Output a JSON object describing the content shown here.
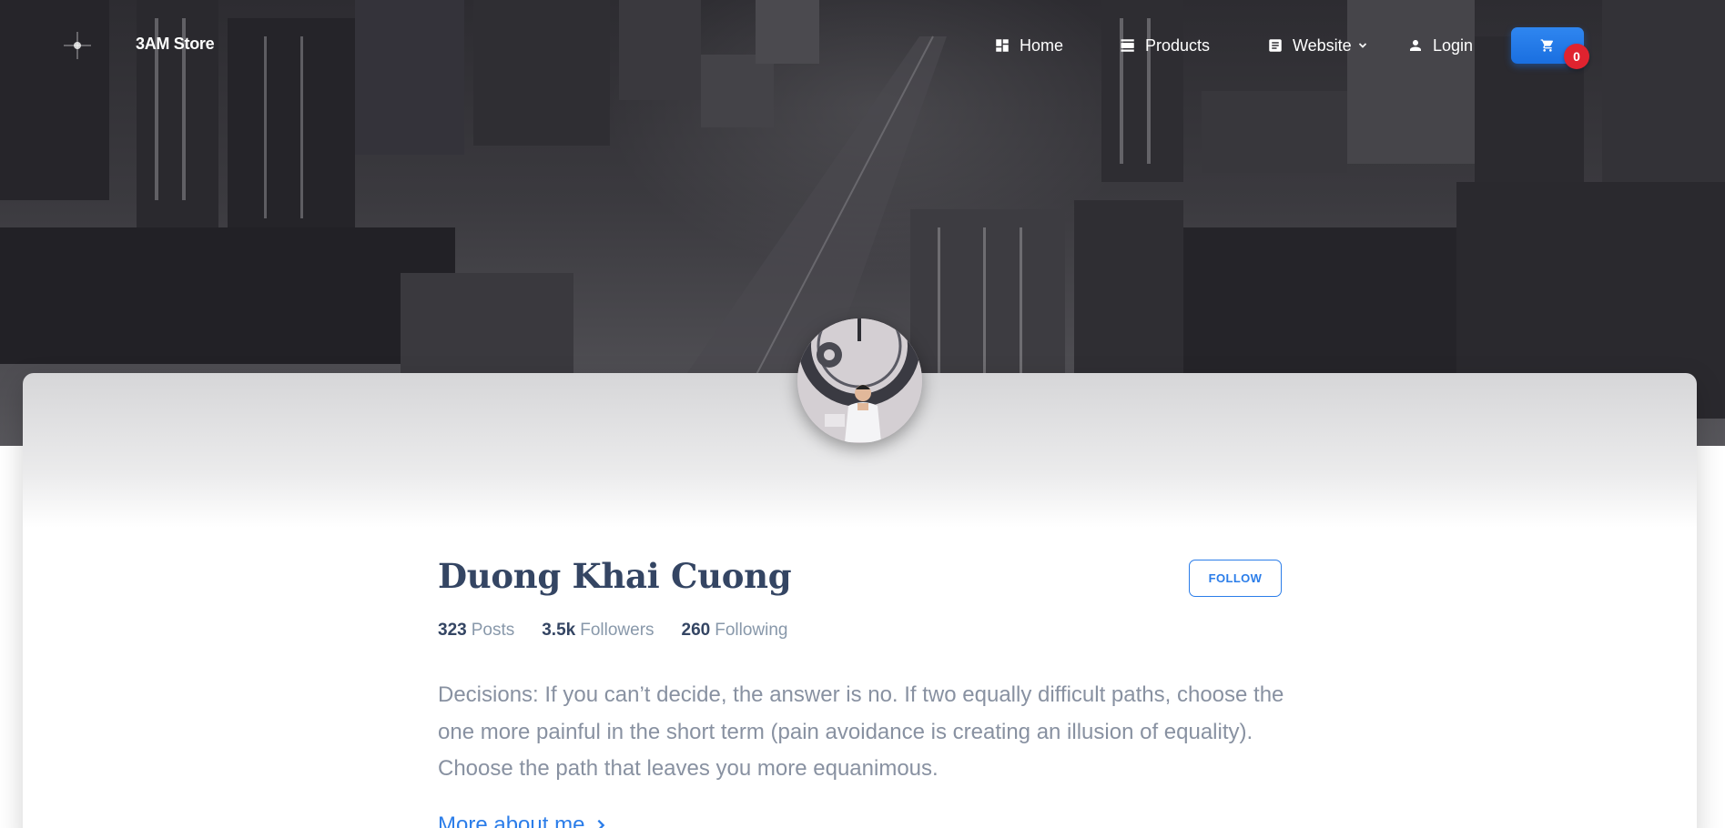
{
  "navbar": {
    "brand": "3AM Store",
    "items": [
      {
        "label": "Home",
        "icon": "dashboard-icon"
      },
      {
        "label": "Products",
        "icon": "view-day-icon"
      },
      {
        "label": "Website",
        "icon": "article-icon",
        "has_dropdown": true
      },
      {
        "label": "Login",
        "icon": "person-icon"
      }
    ],
    "cart": {
      "icon": "shopping-cart-icon",
      "count": "0"
    }
  },
  "colors": {
    "accent": "#2b7de9",
    "badge": "#e0232f",
    "heading": "#344563",
    "muted": "#8898aa"
  },
  "profile": {
    "name": "Duong Khai Cuong",
    "follow_label": "FOLLOW",
    "stats": [
      {
        "value": "323",
        "label": "Posts"
      },
      {
        "value": "3.5k",
        "label": "Followers"
      },
      {
        "value": "260",
        "label": "Following"
      }
    ],
    "bio": "Decisions: If you can’t decide, the answer is no. If two equally difficult paths, choose the one more painful in the short term (pain avoidance is creating an illusion of equality). Choose the path that leaves you more equanimous.",
    "more_link": "More about me"
  }
}
